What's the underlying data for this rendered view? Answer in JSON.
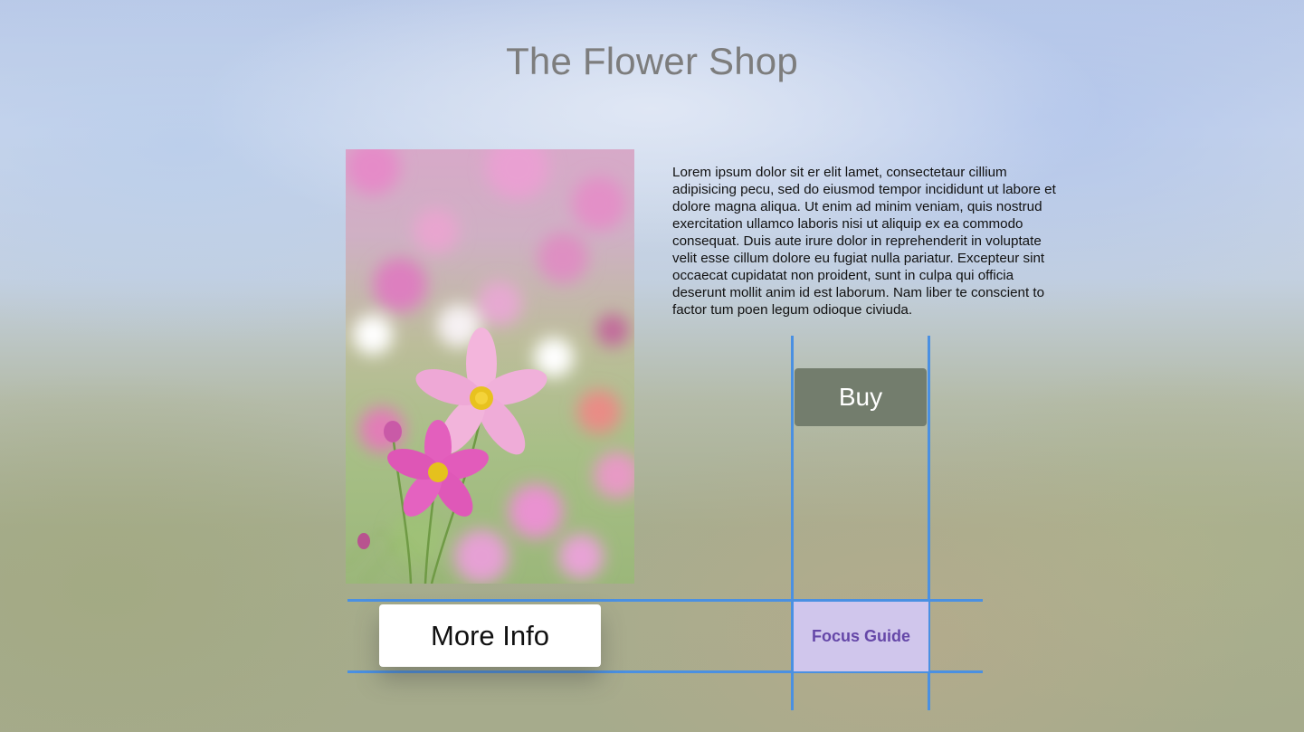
{
  "page": {
    "title": "The Flower Shop"
  },
  "product": {
    "image_subject": "pink-cosmos-flowers-photo",
    "description": "Lorem ipsum dolor sit er elit lamet, consectetaur cillium adipisicing pecu, sed do eiusmod tempor incididunt ut labore et dolore magna aliqua. Ut enim ad minim veniam, quis nostrud exercitation ullamco laboris nisi ut aliquip ex ea commodo consequat. Duis aute irure dolor in reprehenderit in voluptate velit esse cillum dolore eu fugiat nulla pariatur. Excepteur sint occaecat cupidatat non proident, sunt in culpa qui officia deserunt mollit anim id est laborum. Nam liber te conscient to factor tum poen legum odioque civiuda."
  },
  "buttons": {
    "buy_label": "Buy",
    "more_info_label": "More Info"
  },
  "focus_guide": {
    "label": "Focus Guide"
  },
  "colors": {
    "guide_lines": "#4a90e2",
    "focus_guide_fill": "#d0c6ec",
    "focus_guide_text": "#6547a8",
    "buy_button": "#737d6d",
    "title_text": "#7d7d7d"
  }
}
